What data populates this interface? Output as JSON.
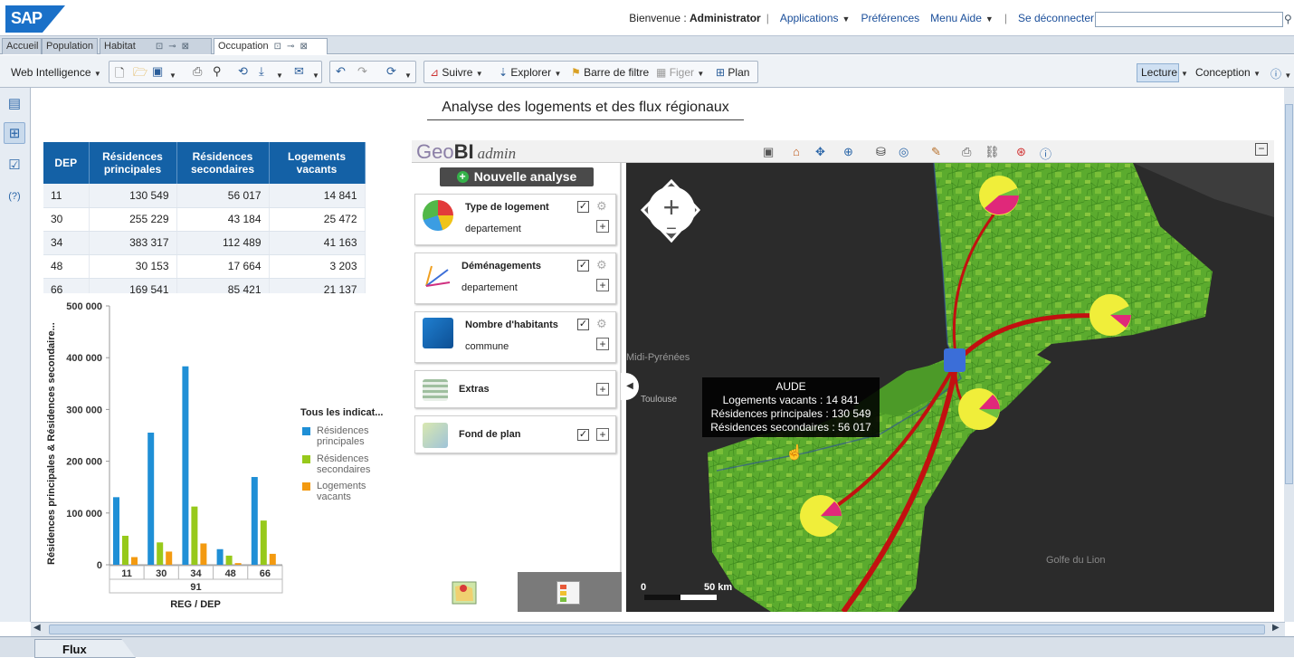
{
  "app": {
    "logo": "SAP"
  },
  "topnav": {
    "welcome_prefix": "Bienvenue :",
    "user": "Administrator",
    "applications": "Applications",
    "preferences": "Préférences",
    "help_menu": "Menu Aide",
    "logout": "Se déconnecter",
    "search_value": ""
  },
  "tabs": [
    {
      "label": "Accueil"
    },
    {
      "label": "Population"
    },
    {
      "label": "Habitat"
    },
    {
      "label": "Occupation"
    }
  ],
  "toolbar": {
    "mode": "Web Intelligence",
    "suivre": "Suivre",
    "explorer": "Explorer",
    "filter_bar": "Barre de filtre",
    "figer": "Figer",
    "plan": "Plan",
    "lecture": "Lecture",
    "conception": "Conception"
  },
  "report": {
    "title": "Analyse des logements et des flux régionaux"
  },
  "table": {
    "headers": [
      "DEP",
      "Résidences principales",
      "Résidences secondaires",
      "Logements vacants"
    ],
    "rows": [
      [
        "11",
        "130 549",
        "56 017",
        "14 841"
      ],
      [
        "30",
        "255 229",
        "43 184",
        "25 472"
      ],
      [
        "34",
        "383 317",
        "112 489",
        "41 163"
      ],
      [
        "48",
        "30 153",
        "17 664",
        "3 203"
      ],
      [
        "66",
        "169 541",
        "85 421",
        "21 137"
      ]
    ]
  },
  "chart_data": {
    "type": "bar",
    "categories": [
      "11",
      "30",
      "34",
      "48",
      "66"
    ],
    "group_label": "91",
    "series": [
      {
        "name": "Résidences principales",
        "color": "#1f8fd6",
        "values": [
          130549,
          255229,
          383317,
          30153,
          169541
        ]
      },
      {
        "name": "Résidences secondaires",
        "color": "#97c91b",
        "values": [
          56017,
          43184,
          112489,
          17664,
          85421
        ]
      },
      {
        "name": "Logements vacants",
        "color": "#f39a10",
        "values": [
          14841,
          25472,
          41163,
          3203,
          21137
        ]
      }
    ],
    "yticks": [
      "500 000",
      "400 000",
      "300 000",
      "200 000",
      "100 000",
      "0"
    ],
    "ylim": [
      0,
      500000
    ],
    "ylabel": "Résidences principales & Résidences secondaire...",
    "xlabel": "REG / DEP",
    "legend_title": "Tous les indicat..."
  },
  "geobi": {
    "logo_geo": "Geo",
    "logo_bi": "BI",
    "logo_admin": "admin",
    "new_analysis": "Nouvelle analyse",
    "layers": [
      {
        "name": "Type de logement",
        "sub": "departement",
        "checked": "✓"
      },
      {
        "name": "Déménagements",
        "sub": "departement",
        "checked": "✓"
      },
      {
        "name": "Nombre d'habitants",
        "sub": "commune",
        "checked": "✓"
      },
      {
        "name": "Extras",
        "sub": "",
        "checked": ""
      },
      {
        "name": "Fond de plan",
        "sub": "",
        "checked": "✓"
      }
    ]
  },
  "map": {
    "label_region": "Midi-Pyrénées",
    "label_city": "Toulouse",
    "label_sea": "Golfe du Lion",
    "scale_zero": "0",
    "scale_label": "50 km",
    "tooltip": {
      "title": "AUDE",
      "line1": "Logements vacants : 14 841",
      "line2": "Résidences principales : 130 549",
      "line3": "Résidences secondaires : 56 017"
    }
  },
  "bottom": {
    "tab": "Flux"
  }
}
